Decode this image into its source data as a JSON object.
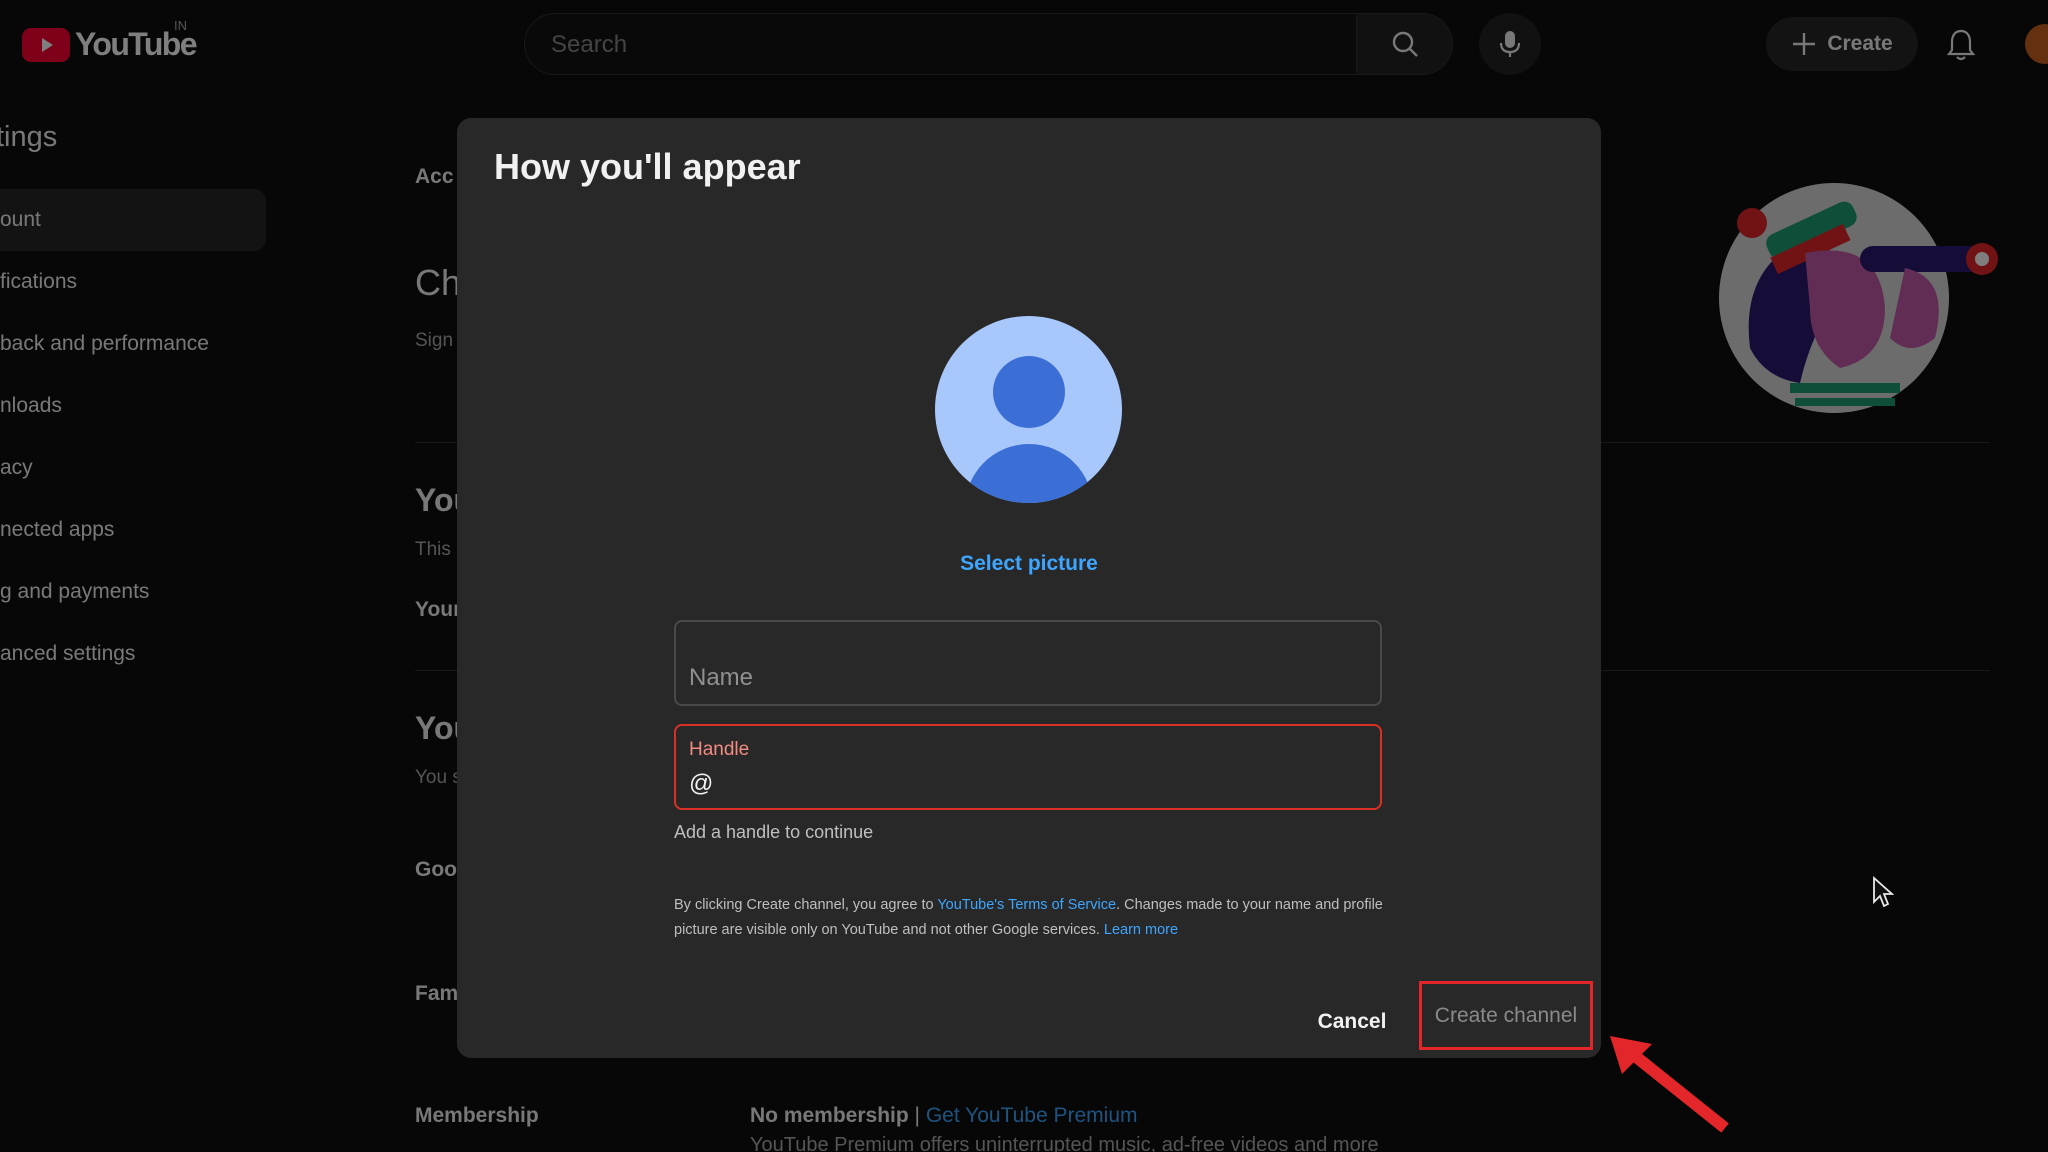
{
  "header": {
    "logo_text": "YouTube",
    "country_code": "IN",
    "search_placeholder": "Search",
    "create_label": "Create"
  },
  "sidebar": {
    "title": "tings",
    "items": [
      {
        "label": "ount",
        "active": true
      },
      {
        "label": "fications"
      },
      {
        "label": "back and performance"
      },
      {
        "label": "nloads"
      },
      {
        "label": "acy"
      },
      {
        "label": "nected apps"
      },
      {
        "label": "g and payments"
      },
      {
        "label": "anced settings"
      }
    ]
  },
  "main": {
    "account_label": "Acc",
    "channel_heading": "Ch",
    "signed_in_text": "Sign",
    "your_heading_1": "You",
    "this_text": "This",
    "your_label": "Your",
    "your_heading_2": "You",
    "you_text": "You s",
    "google_label": "Goo",
    "family_label": "Fam",
    "membership_label": "Membership",
    "membership_value": "No membership",
    "membership_separator": " | ",
    "membership_link": "Get YouTube Premium",
    "membership_sub": "YouTube Premium offers uninterrupted music, ad-free videos and more"
  },
  "dialog": {
    "title": "How you'll appear",
    "select_picture": "Select picture",
    "name_placeholder": "Name",
    "handle_label": "Handle",
    "handle_prefix": "@",
    "helper_text": "Add a handle to continue",
    "terms_prefix": "By clicking Create channel, you agree to ",
    "terms_link": "YouTube's Terms of Service",
    "terms_middle": ". Changes made to your name and profile picture are visible only on YouTube and not other Google services. ",
    "learn_more": "Learn more",
    "cancel_label": "Cancel",
    "create_label": "Create channel"
  },
  "colors": {
    "brand_red": "#ff0033",
    "link_blue": "#3ea6ff",
    "error_red": "#d93025",
    "highlight_red": "#e3262a"
  }
}
